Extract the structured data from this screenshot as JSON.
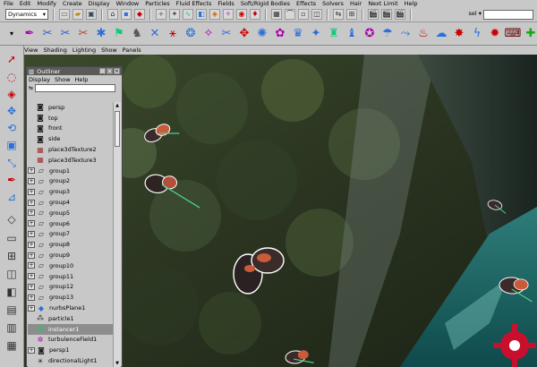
{
  "menu": [
    "File",
    "Edit",
    "Modify",
    "Create",
    "Display",
    "Window",
    "Particles",
    "Fluid Effects",
    "Fields",
    "Soft/Rigid Bodies",
    "Effects",
    "Solvers",
    "Hair",
    "Next Limit",
    "Help"
  ],
  "status_line": {
    "mode": "Dynamics",
    "icons": [
      "folder-icon",
      "open-icon",
      "save-icon",
      "select-hierarchy-icon",
      "select-object-icon",
      "select-component-icon",
      "snap-grid-icon",
      "snap-curve-icon",
      "snap-point-icon",
      "snap-plane-icon",
      "history-icon",
      "render-icon",
      "ipr-icon",
      "render-globals-icon"
    ],
    "cell_label": "sel ▾",
    "mel_label": ""
  },
  "shelf": {
    "icons": [
      "torch-icon",
      "spring-icon",
      "soft-body-icon",
      "rigid-body-icon",
      "emitter-icon",
      "goal-icon",
      "collide-icon",
      "field-icon",
      "newton-icon",
      "radial-icon",
      "turbulence-icon",
      "vortex-icon",
      "uniform-icon",
      "air-icon",
      "drag-icon",
      "gravity-icon",
      "volume-axis-icon",
      "instancer-icon",
      "sprite-icon",
      "glow-icon",
      "particle-tool-icon",
      "curve-flow-icon",
      "fire-icon",
      "smoke-icon",
      "fireworks-icon",
      "lightning-icon",
      "shatter-icon",
      "keyboard-icon",
      "create-icon",
      "dynamic-icon",
      "pin-icon",
      "marker-icon",
      "mel-icon"
    ],
    "mel_text": "mel"
  },
  "toolbox": [
    "select-tool-icon",
    "lasso-tool-icon",
    "paint-tool-icon",
    "move-tool-icon",
    "rotate-tool-icon",
    "scale-tool-icon",
    "manipulator-tool-icon",
    "soft-mod-icon",
    "show-manip-icon",
    "last-tool-icon",
    "single-view-icon",
    "four-view-icon",
    "persp-outliner-icon",
    "persp-graph-icon",
    "hypergraph-icon",
    "graph-editor-icon"
  ],
  "viewport_menu": [
    "View",
    "Shading",
    "Lighting",
    "Show",
    "Panels"
  ],
  "outliner": {
    "title": "Outliner",
    "menu": [
      "Display",
      "Show",
      "Help"
    ],
    "items": [
      {
        "name": "persp",
        "icon": "camera",
        "exp": false,
        "selected": false
      },
      {
        "name": "top",
        "icon": "camera",
        "exp": false,
        "selected": false
      },
      {
        "name": "front",
        "icon": "camera",
        "exp": false,
        "selected": false
      },
      {
        "name": "side",
        "icon": "camera",
        "exp": false,
        "selected": false
      },
      {
        "name": "place3dTexture2",
        "icon": "texture",
        "exp": false,
        "selected": false
      },
      {
        "name": "place3dTexture3",
        "icon": "texture",
        "exp": false,
        "selected": false
      },
      {
        "name": "group1",
        "icon": "group",
        "exp": true,
        "selected": false
      },
      {
        "name": "group2",
        "icon": "group",
        "exp": true,
        "selected": false
      },
      {
        "name": "group3",
        "icon": "group",
        "exp": true,
        "selected": false
      },
      {
        "name": "group4",
        "icon": "group",
        "exp": true,
        "selected": false
      },
      {
        "name": "group5",
        "icon": "group",
        "exp": true,
        "selected": false
      },
      {
        "name": "group6",
        "icon": "group",
        "exp": true,
        "selected": false
      },
      {
        "name": "group7",
        "icon": "group",
        "exp": true,
        "selected": false
      },
      {
        "name": "group8",
        "icon": "group",
        "exp": true,
        "selected": false
      },
      {
        "name": "group9",
        "icon": "group",
        "exp": true,
        "selected": false
      },
      {
        "name": "group10",
        "icon": "group",
        "exp": true,
        "selected": false
      },
      {
        "name": "group11",
        "icon": "group",
        "exp": true,
        "selected": false
      },
      {
        "name": "group12",
        "icon": "group",
        "exp": true,
        "selected": false
      },
      {
        "name": "group13",
        "icon": "group",
        "exp": true,
        "selected": false
      },
      {
        "name": "nurbsPlane1",
        "icon": "nurbs",
        "exp": true,
        "selected": false
      },
      {
        "name": "particle1",
        "icon": "particle",
        "exp": false,
        "selected": false
      },
      {
        "name": "instancer1",
        "icon": "instancer",
        "exp": false,
        "selected": true
      },
      {
        "name": "turbulenceField1",
        "icon": "field",
        "exp": false,
        "selected": false
      },
      {
        "name": "persp1",
        "icon": "camera",
        "exp": true,
        "selected": false
      },
      {
        "name": "directionalLight1",
        "icon": "light",
        "exp": false,
        "selected": false
      }
    ]
  },
  "colors": {
    "ui_gray": "#c8c8c8",
    "title_bar": "#5a5a5a",
    "selected_row": "#8d8d8d",
    "water": "#1e6b6b",
    "foliage": "#2f3d23",
    "accent_red": "#c8102e"
  }
}
